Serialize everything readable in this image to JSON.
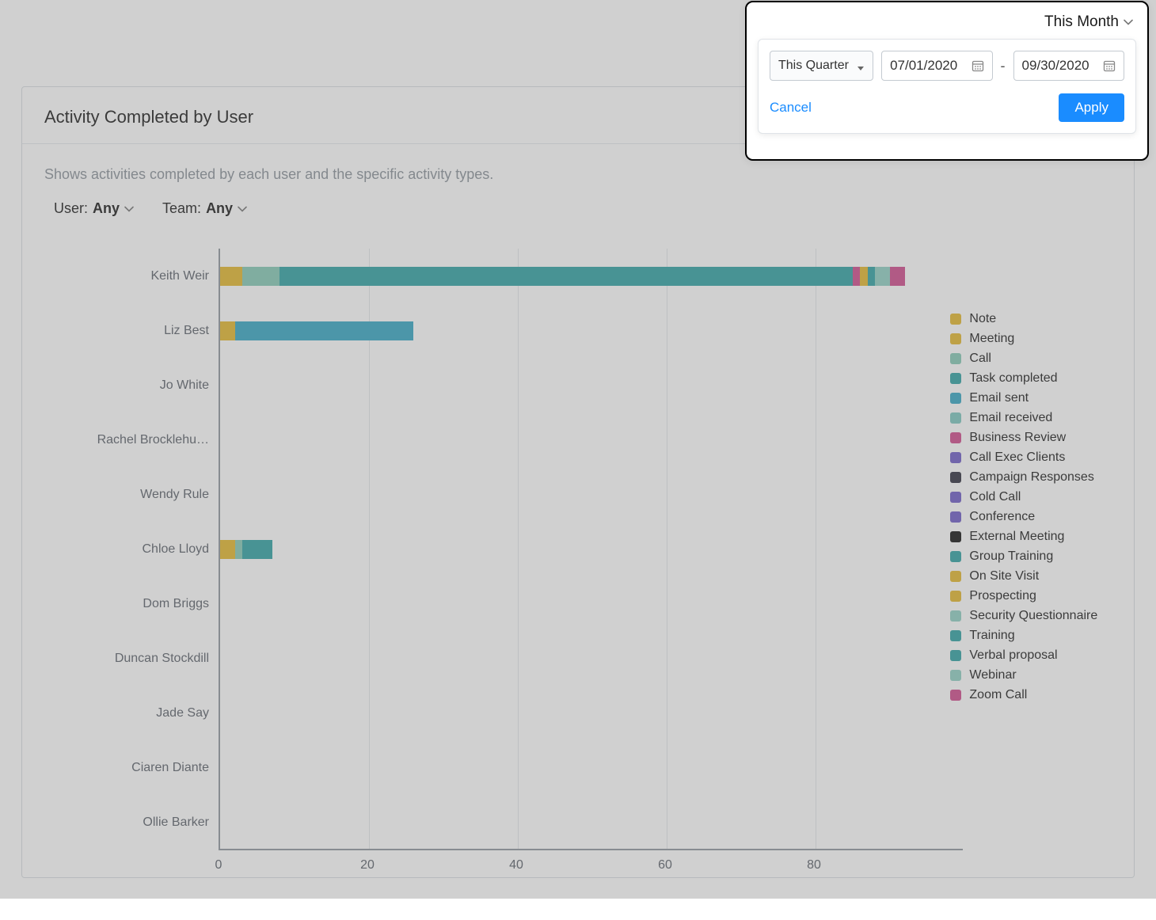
{
  "header": {
    "date_filter_label": "This Month"
  },
  "popover": {
    "preset": "This Quarter",
    "start_date": "07/01/2020",
    "end_date": "09/30/2020",
    "cancel_label": "Cancel",
    "apply_label": "Apply"
  },
  "card": {
    "title": "Activity Completed by User",
    "description": "Shows activities completed by each user and the specific activity types."
  },
  "filters": {
    "user_label": "User:",
    "user_value": "Any",
    "team_label": "Team:",
    "team_value": "Any"
  },
  "legend": [
    {
      "name": "Note",
      "color": "#e3b72b"
    },
    {
      "name": "Meeting",
      "color": "#e3b72b"
    },
    {
      "name": "Call",
      "color": "#84c9b6"
    },
    {
      "name": "Task completed",
      "color": "#2ea2a3"
    },
    {
      "name": "Email sent",
      "color": "#35a6c4"
    },
    {
      "name": "Email received",
      "color": "#7cc6bf"
    },
    {
      "name": "Business Review",
      "color": "#cf4b8c"
    },
    {
      "name": "Call Exec Clients",
      "color": "#6e5bc6"
    },
    {
      "name": "Campaign Responses",
      "color": "#2f2f3e"
    },
    {
      "name": "Cold Call",
      "color": "#6e5bc6"
    },
    {
      "name": "Conference",
      "color": "#6e5bc6"
    },
    {
      "name": "External Meeting",
      "color": "#111111"
    },
    {
      "name": "Group Training",
      "color": "#2ea2a3"
    },
    {
      "name": "On Site Visit",
      "color": "#e3b72b"
    },
    {
      "name": "Prospecting",
      "color": "#e3b72b"
    },
    {
      "name": "Security Questionnaire",
      "color": "#8fcfc4"
    },
    {
      "name": "Training",
      "color": "#2ea2a3"
    },
    {
      "name": "Verbal proposal",
      "color": "#2ea2a3"
    },
    {
      "name": "Webinar",
      "color": "#8fcfc4"
    },
    {
      "name": "Zoom Call",
      "color": "#cf4b8c"
    }
  ],
  "chart_data": {
    "type": "bar",
    "orientation": "horizontal",
    "stacked": true,
    "xlabel": "",
    "ylabel": "",
    "xlim": [
      0,
      100
    ],
    "xticks": [
      0,
      20,
      40,
      60,
      80
    ],
    "categories": [
      "Keith Weir",
      "Liz Best",
      "Jo White",
      "Rachel Brocklehu…",
      "Wendy Rule",
      "Chloe Lloyd",
      "Dom Briggs",
      "Duncan Stockdill",
      "Jade Say",
      "Ciaren Diante",
      "Ollie Barker"
    ],
    "rows": [
      {
        "name": "Keith Weir",
        "segments": [
          {
            "series": "Meeting",
            "value": 3,
            "color": "#e3b72b"
          },
          {
            "series": "Call",
            "value": 5,
            "color": "#84c9b6"
          },
          {
            "series": "Task completed",
            "value": 77,
            "color": "#2ea2a3"
          },
          {
            "series": "Business Review",
            "value": 1,
            "color": "#cf4b8c"
          },
          {
            "series": "On Site Visit",
            "value": 1,
            "color": "#e3b72b"
          },
          {
            "series": "Training",
            "value": 1,
            "color": "#2ea2a3"
          },
          {
            "series": "Webinar",
            "value": 2,
            "color": "#8fcfc4"
          },
          {
            "series": "Zoom Call",
            "value": 2,
            "color": "#cf4b8c"
          }
        ]
      },
      {
        "name": "Liz Best",
        "segments": [
          {
            "series": "Meeting",
            "value": 2,
            "color": "#e3b72b"
          },
          {
            "series": "Email sent",
            "value": 24,
            "color": "#35a6c4"
          }
        ]
      },
      {
        "name": "Jo White",
        "segments": []
      },
      {
        "name": "Rachel Brocklehu…",
        "segments": []
      },
      {
        "name": "Wendy Rule",
        "segments": []
      },
      {
        "name": "Chloe Lloyd",
        "segments": [
          {
            "series": "Meeting",
            "value": 2,
            "color": "#e3b72b"
          },
          {
            "series": "Call",
            "value": 1,
            "color": "#84c9b6"
          },
          {
            "series": "Task completed",
            "value": 4,
            "color": "#2ea2a3"
          }
        ]
      },
      {
        "name": "Dom Briggs",
        "segments": []
      },
      {
        "name": "Duncan Stockdill",
        "segments": []
      },
      {
        "name": "Jade Say",
        "segments": []
      },
      {
        "name": "Ciaren Diante",
        "segments": []
      },
      {
        "name": "Ollie Barker",
        "segments": []
      }
    ]
  }
}
